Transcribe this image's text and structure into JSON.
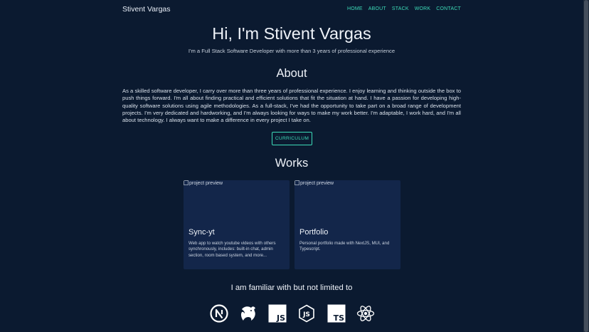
{
  "nav": {
    "brand": "Stivent Vargas",
    "links": [
      "HOME",
      "ABOUT",
      "STACK",
      "WORK",
      "CONTACT"
    ]
  },
  "hero": {
    "title": "Hi, I'm Stivent Vargas",
    "subtitle": "I'm a Full Stack Software Developer with more than 3 years of professional experience"
  },
  "about": {
    "heading": "About",
    "text": "As a skilled software developer, I carry over more than three years of professional experience. I enjoy learning and thinking outside the box to push things forward. I'm all about finding practical and efficient solutions that fit the situation at hand. I have a passion for developing high-quality software solutions using agile methodologies. As a full-stack, I've had the opportunity to take part on a broad range of development projects. I'm very dedicated and hardworking, and I'm always looking for ways to make my work better. I'm adaptable, I work hard, and I'm all about technology. I always want to make a difference in every project I take on.",
    "button": "CURRICULUM"
  },
  "works": {
    "heading": "Works",
    "projects": [
      {
        "image_alt": "project preview",
        "title": "Sync-yt",
        "description": "Web app to watch youtube videos with others synchronously, includes: built-in chat, admin section, room based system, and more..."
      },
      {
        "image_alt": "project preview",
        "title": "Portfolio",
        "description": "Personal portfolio made with NextJS, MUI, and Typescript."
      }
    ]
  },
  "stack": {
    "heading": "I am familiar with but not limited to",
    "icons": [
      "nextjs-icon",
      "nestjs-icon",
      "javascript-icon",
      "nodejs-icon",
      "typescript-icon",
      "react-icon"
    ]
  },
  "colors": {
    "background": "#0b1a30",
    "accent": "#3ddbb8",
    "card": "#13264a"
  }
}
